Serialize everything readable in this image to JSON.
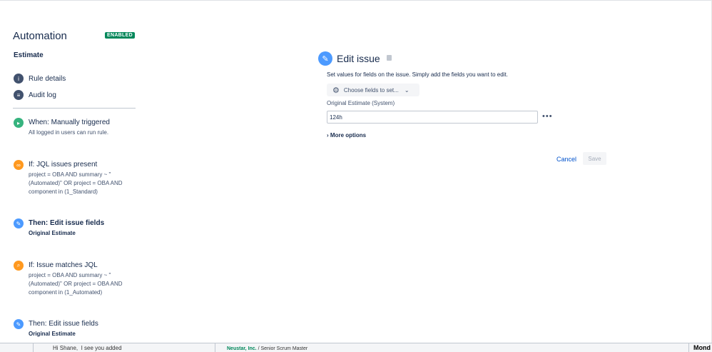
{
  "sidebar": {
    "app_title": "Automation",
    "status_badge": "ENABLED",
    "rule_name": "Estimate",
    "nav": [
      {
        "label": "Rule details",
        "icon": "info-icon"
      },
      {
        "label": "Audit log",
        "icon": "list-icon"
      }
    ],
    "steps": [
      {
        "title": "When: Manually triggered",
        "desc": "All logged in users can run rule.",
        "icon": "trigger-icon",
        "color": "#36b37e"
      },
      {
        "title": "If: JQL issues present",
        "desc": "project = OBA AND summary ~ \"(Automated)\" OR project = OBA AND component in (1_Standard)",
        "icon": "link-icon",
        "color": "#ff991f"
      },
      {
        "title": "Then: Edit issue fields",
        "desc": "Original Estimate",
        "icon": "pencil-icon",
        "color": "#4c9aff",
        "selected": true
      },
      {
        "title": "If: Issue matches JQL",
        "desc": "project = OBA AND summary ~ \"(Automated)\" OR project = OBA AND component in (1_Automated)",
        "icon": "search-icon",
        "color": "#ff991f"
      },
      {
        "title": "Then: Edit issue fields",
        "desc": "Original Estimate",
        "icon": "pencil-icon",
        "color": "#4c9aff"
      }
    ]
  },
  "panel": {
    "title": "Edit issue",
    "description": "Set values for fields on the issue. Simply add the fields you want to edit.",
    "choose_fields": "Choose fields to set...",
    "field_label": "Original Estimate (System)",
    "field_value": "124h",
    "more_options": "More options",
    "cancel": "Cancel",
    "save": "Save"
  },
  "background": {
    "chat_snippet": "Hi Shane,  I see you added",
    "company": "Neustar, Inc.",
    "job": "/ Senior Scrum Master",
    "day": "Mond"
  }
}
